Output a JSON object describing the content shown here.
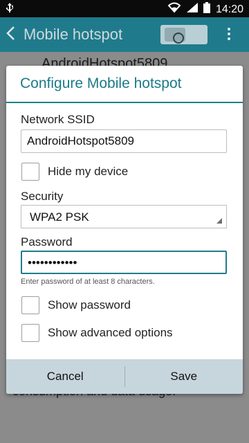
{
  "statusbar": {
    "time": "14:20",
    "usb_icon": "usb-icon",
    "wifi_icon": "wifi-icon",
    "signal_icon": "cell-signal-icon",
    "battery_icon": "battery-icon"
  },
  "appbar": {
    "title": "Mobile hotspot",
    "toggle_on": false
  },
  "background": {
    "row_text": "AndroidHotspot5809",
    "foot_text": "consumption and data usage."
  },
  "dialog": {
    "title": "Configure Mobile hotspot",
    "ssid_label": "Network SSID",
    "ssid_value": "AndroidHotspot5809",
    "hide_device_label": "Hide my device",
    "security_label": "Security",
    "security_value": "WPA2 PSK",
    "password_label": "Password",
    "password_value": "••••••••••••",
    "password_hint": "Enter password of at least 8 characters.",
    "show_password_label": "Show password",
    "show_advanced_label": "Show advanced options",
    "cancel_label": "Cancel",
    "save_label": "Save"
  },
  "colors": {
    "accent": "#1f7b8c",
    "button_bar": "#c7d5dc"
  }
}
